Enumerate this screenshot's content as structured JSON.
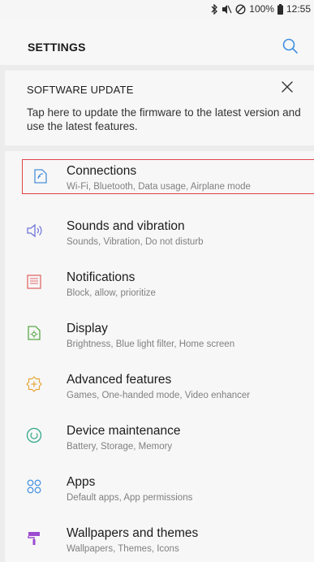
{
  "status_bar": {
    "battery": "100%",
    "time": "12:55"
  },
  "header": {
    "title": "SETTINGS"
  },
  "software_update": {
    "heading": "SOFTWARE UPDATE",
    "body": "Tap here to update the firmware to the latest version and use the latest features."
  },
  "items": [
    {
      "label": "Connections",
      "sub": "Wi-Fi, Bluetooth, Data usage, Airplane mode",
      "icon": "connections-icon",
      "color": "#4a90d9"
    },
    {
      "label": "Sounds and vibration",
      "sub": "Sounds, Vibration, Do not disturb",
      "icon": "sound-icon",
      "color": "#6e73d9"
    },
    {
      "label": "Notifications",
      "sub": "Block, allow, prioritize",
      "icon": "notifications-icon",
      "color": "#e36a6a"
    },
    {
      "label": "Display",
      "sub": "Brightness, Blue light filter, Home screen",
      "icon": "display-icon",
      "color": "#5ba84a"
    },
    {
      "label": "Advanced features",
      "sub": "Games, One-handed mode, Video enhancer",
      "icon": "advanced-features-icon",
      "color": "#e8a73a"
    },
    {
      "label": "Device maintenance",
      "sub": "Battery, Storage, Memory",
      "icon": "device-maintenance-icon",
      "color": "#34a88a"
    },
    {
      "label": "Apps",
      "sub": "Default apps, App permissions",
      "icon": "apps-icon",
      "color": "#3f8fe0"
    },
    {
      "label": "Wallpapers and themes",
      "sub": "Wallpapers, Themes, Icons",
      "icon": "wallpapers-themes-icon",
      "color": "#9c4bd1"
    }
  ],
  "colors": {
    "highlight": "#e3414b",
    "accent": "#3f8fe0"
  }
}
